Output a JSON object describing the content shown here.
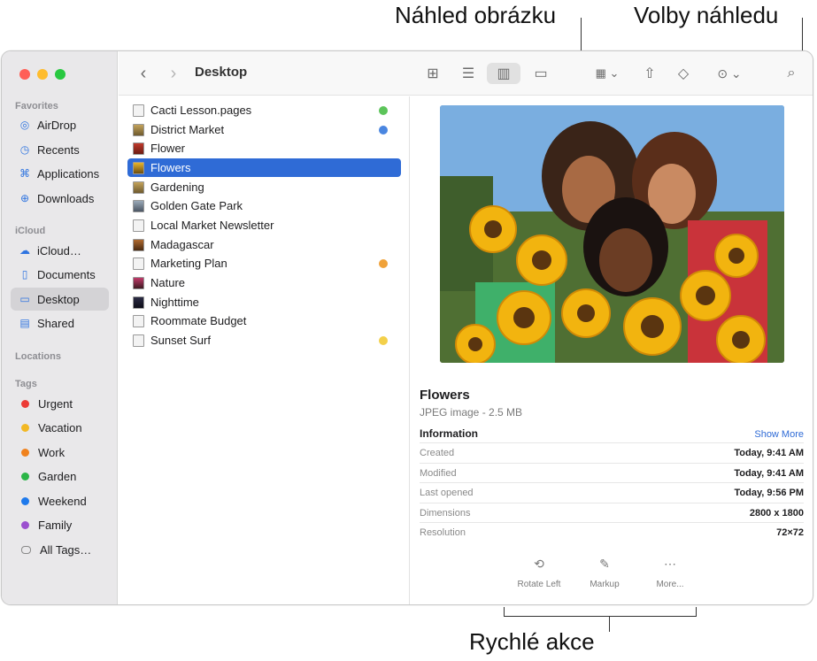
{
  "callouts": {
    "preview": "Náhled obrázku",
    "options": "Volby náhledu",
    "quick": "Rychlé akce"
  },
  "window": {
    "path_title": "Desktop"
  },
  "sidebar": {
    "favorites_header": "Favorites",
    "favorites": [
      {
        "label": "AirDrop",
        "icon": "airdrop-icon"
      },
      {
        "label": "Recents",
        "icon": "clock-icon"
      },
      {
        "label": "Applications",
        "icon": "applications-icon"
      },
      {
        "label": "Downloads",
        "icon": "download-icon"
      }
    ],
    "icloud_header": "iCloud",
    "icloud": [
      {
        "label": "iCloud…",
        "icon": "cloud-icon"
      },
      {
        "label": "Documents",
        "icon": "document-icon"
      },
      {
        "label": "Desktop",
        "icon": "desktop-icon",
        "selected": true
      },
      {
        "label": "Shared",
        "icon": "shared-folder-icon"
      }
    ],
    "locations_header": "Locations",
    "tags_header": "Tags",
    "tags": [
      {
        "label": "Urgent",
        "color": "#ec3b36"
      },
      {
        "label": "Vacation",
        "color": "#f2b824"
      },
      {
        "label": "Work",
        "color": "#f0821e"
      },
      {
        "label": "Garden",
        "color": "#2bb547"
      },
      {
        "label": "Weekend",
        "color": "#1f7aec"
      },
      {
        "label": "Family",
        "color": "#9b4fcf"
      },
      {
        "label": "All Tags…",
        "color": ""
      }
    ]
  },
  "files": [
    {
      "name": "Cacti Lesson.pages",
      "tag": "#5cc45a"
    },
    {
      "name": "District Market",
      "tag": "#4a86e0"
    },
    {
      "name": "Flower",
      "tag": ""
    },
    {
      "name": "Flowers",
      "tag": "",
      "selected": true
    },
    {
      "name": "Gardening",
      "tag": ""
    },
    {
      "name": "Golden Gate Park",
      "tag": ""
    },
    {
      "name": "Local Market Newsletter",
      "tag": ""
    },
    {
      "name": "Madagascar",
      "tag": ""
    },
    {
      "name": "Marketing Plan",
      "tag": "#f0a23a"
    },
    {
      "name": "Nature",
      "tag": ""
    },
    {
      "name": "Nighttime",
      "tag": ""
    },
    {
      "name": "Roommate Budget",
      "tag": ""
    },
    {
      "name": "Sunset Surf",
      "tag": "#f3d04a"
    }
  ],
  "preview": {
    "title": "Flowers",
    "kind": "JPEG image - 2.5 MB",
    "info_header": "Information",
    "show_more": "Show More",
    "rows": [
      {
        "key": "Created",
        "value": "Today, 9:41 AM"
      },
      {
        "key": "Modified",
        "value": "Today, 9:41 AM"
      },
      {
        "key": "Last opened",
        "value": "Today, 9:56 PM"
      },
      {
        "key": "Dimensions",
        "value": "2800 x 1800"
      },
      {
        "key": "Resolution",
        "value": "72×72"
      }
    ],
    "actions": [
      {
        "label": "Rotate Left",
        "icon": "rotate-left-icon"
      },
      {
        "label": "Markup",
        "icon": "markup-icon"
      },
      {
        "label": "More...",
        "icon": "more-icon"
      }
    ]
  }
}
